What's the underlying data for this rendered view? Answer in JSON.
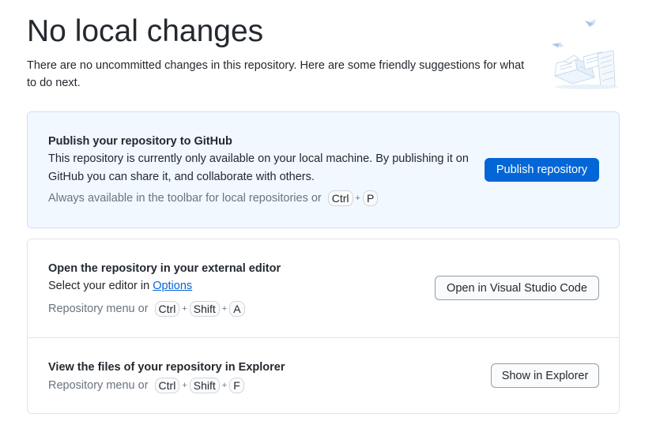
{
  "header": {
    "title": "No local changes",
    "intro": "There are no uncommitted changes in this repository. Here are some friendly suggestions for what to do next."
  },
  "publish": {
    "heading": "Publish your repository to GitHub",
    "description": "This repository is currently only available on your local machine. By publishing it on GitHub you can share it, and collaborate with others.",
    "hint_prefix": "Always available in the toolbar for local repositories or",
    "keys": [
      "Ctrl",
      "P"
    ],
    "button_label": "Publish repository"
  },
  "editor": {
    "heading": "Open the repository in your external editor",
    "description_prefix": "Select your editor in",
    "options_link": "Options",
    "hint_prefix": "Repository menu or",
    "keys": [
      "Ctrl",
      "Shift",
      "A"
    ],
    "button_label": "Open in Visual Studio Code"
  },
  "explorer": {
    "heading": "View the files of your repository in Explorer",
    "hint_prefix": "Repository menu or",
    "keys": [
      "Ctrl",
      "Shift",
      "F"
    ],
    "button_label": "Show in Explorer"
  },
  "colors": {
    "accent": "#0366d6",
    "highlight_bg": "#f1f8ff",
    "muted_text": "#6a737d"
  },
  "icons": {
    "illustration": "paper-stack-illustration"
  }
}
